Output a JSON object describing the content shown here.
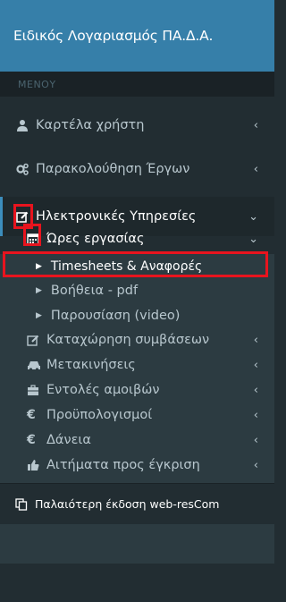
{
  "header": {
    "title": "Ειδικός Λογαριασμός ΠΑ.Δ.Α."
  },
  "menu": {
    "section_label": "ΜΕΝΟΥ",
    "items": [
      {
        "label": "Καρτέλα χρήστη",
        "icon": "user-icon"
      },
      {
        "label": "Παρακολούθηση Έργων",
        "icon": "cogs-icon"
      },
      {
        "label": "Ηλεκτρονικές Υπηρεσίες",
        "icon": "edit-icon"
      }
    ],
    "submenu": {
      "parent": {
        "label": "Ώρες εργασίας",
        "icon": "calendar-icon"
      },
      "children": [
        {
          "label": "Timesheets & Αναφορές"
        },
        {
          "label": "Βοήθεια - pdf"
        },
        {
          "label": "Παρουσίαση (video)"
        }
      ],
      "siblings": [
        {
          "label": "Καταχώρηση συμβάσεων",
          "icon": "edit-icon"
        },
        {
          "label": "Μετακινήσεις",
          "icon": "car-icon"
        },
        {
          "label": "Εντολές αμοιβών",
          "icon": "briefcase-icon"
        },
        {
          "label": "Προϋπολογισμοί",
          "icon": "euro-icon"
        },
        {
          "label": "Δάνεια",
          "icon": "euro-icon"
        },
        {
          "label": "Αιτήματα προς έγκριση",
          "icon": "thumbs-up-icon"
        }
      ]
    },
    "footer": {
      "label": "Παλαιότερη έκδοση web-resCom",
      "icon": "copy-icon"
    }
  },
  "colors": {
    "sidebar": "#222d32",
    "header": "#367fa9",
    "highlight": "#e8141e",
    "accent": "#3c8dbc"
  }
}
